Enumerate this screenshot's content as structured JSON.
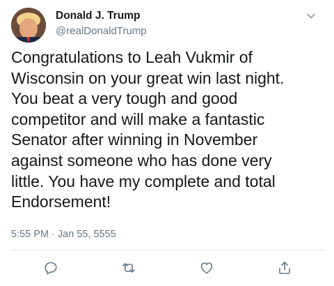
{
  "author": {
    "display_name": "Donald J. Trump",
    "handle": "@realDonaldTrump",
    "avatar_icon": "profile-avatar"
  },
  "tweet": {
    "text": "Congratulations to Leah Vukmir of\nWisconsin on your great win last night.\nYou beat a very tough and good\ncompetitor and will make a fantastic\nSenator after winning in November\nagainst someone who has done very\nlittle. You have my complete and total\nEndorsement!",
    "timestamp": "5:55 PM · Jan 55, 5555"
  },
  "actions": {
    "reply_icon": "reply-icon",
    "retweet_icon": "retweet-icon",
    "like_icon": "heart-icon",
    "share_icon": "share-icon"
  },
  "colors": {
    "text": "#14171a",
    "secondary": "#657786",
    "icon": "#657786",
    "divider": "#e1e8ed"
  }
}
